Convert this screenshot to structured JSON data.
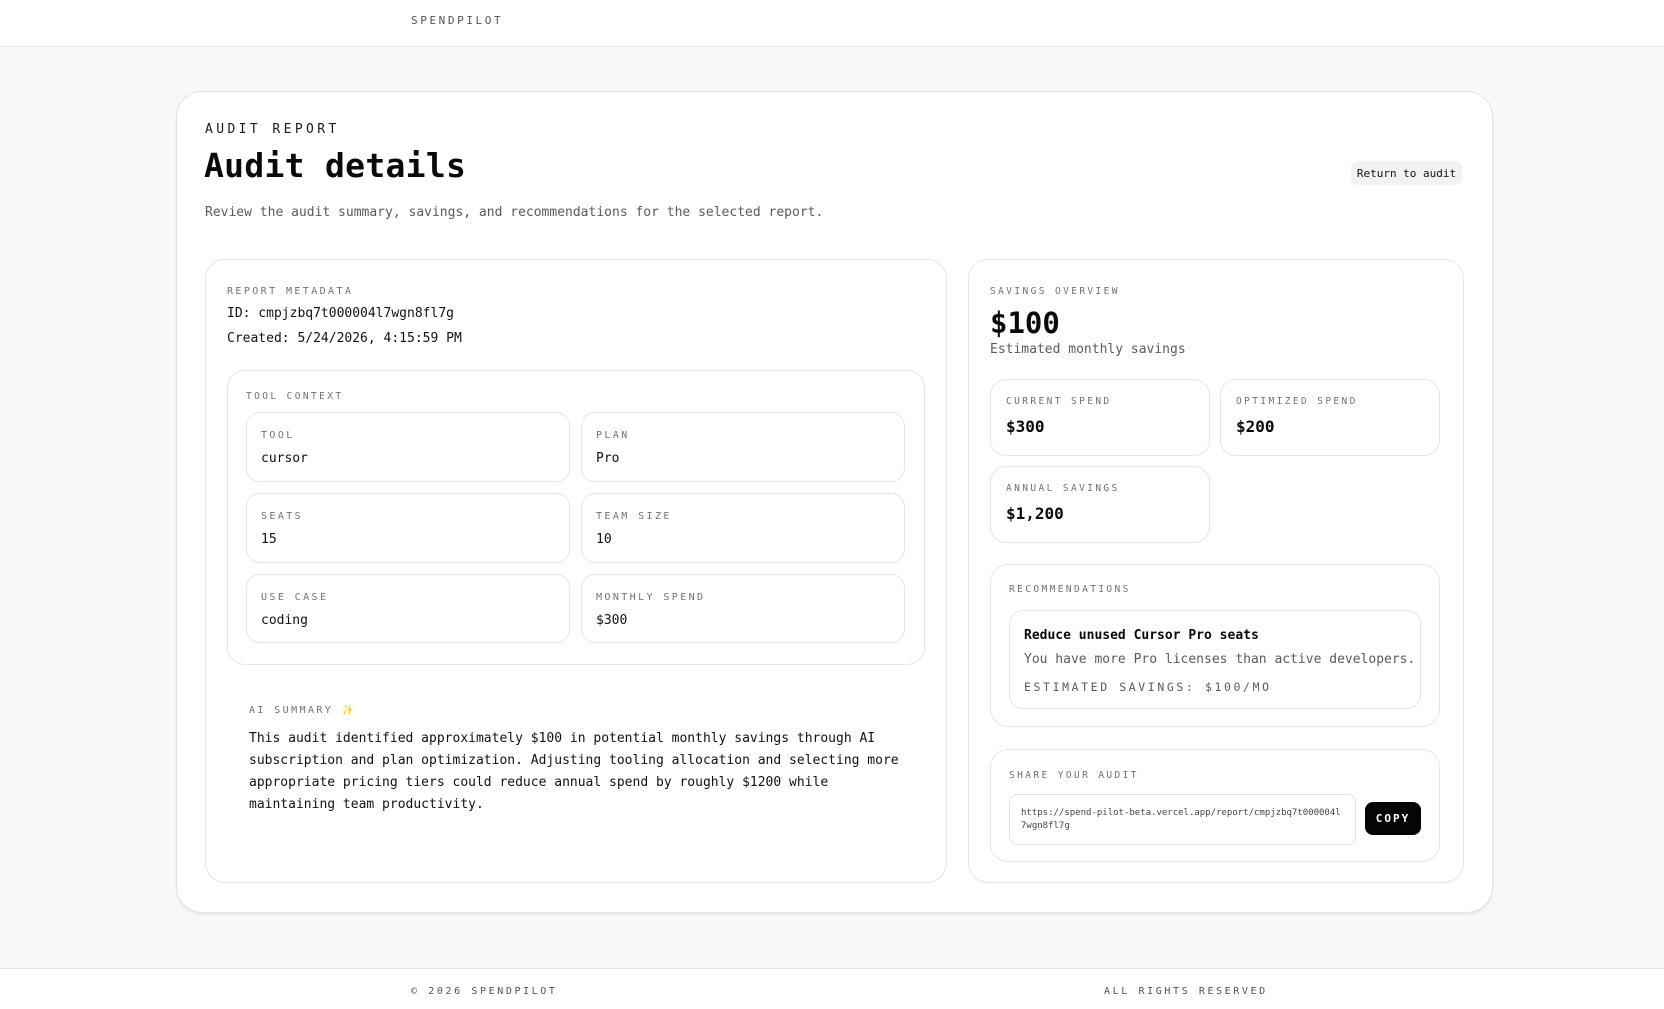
{
  "brand": "SPENDPILOT",
  "header": {
    "eyebrow": "AUDIT REPORT",
    "title": "Audit details",
    "subtitle": "Review the audit summary, savings, and recommendations for the selected report.",
    "return_label": "Return to audit"
  },
  "metadata": {
    "label": "REPORT METADATA",
    "id_line": "ID: cmpjzbq7t000004l7wgn8fl7g",
    "created_line": "Created: 5/24/2026, 4:15:59 PM"
  },
  "tool_context": {
    "label": "TOOL CONTEXT",
    "fields": [
      {
        "label": "TOOL",
        "value": "cursor"
      },
      {
        "label": "PLAN",
        "value": "Pro"
      },
      {
        "label": "SEATS",
        "value": "15"
      },
      {
        "label": "TEAM SIZE",
        "value": "10"
      },
      {
        "label": "USE CASE",
        "value": "coding"
      },
      {
        "label": "MONTHLY SPEND",
        "value": "$300"
      }
    ]
  },
  "ai_summary": {
    "label": "AI SUMMARY",
    "icon": "sparkle-icon",
    "icon_glyph": "✨",
    "text": "This audit identified approximately $100 in potential monthly savings through AI subscription and plan optimization. Adjusting tooling allocation and selecting more appropriate pricing tiers could reduce annual spend by roughly $1200 while maintaining team productivity."
  },
  "savings": {
    "label": "SAVINGS OVERVIEW",
    "amount": "$100",
    "amount_caption": "Estimated monthly savings",
    "stats": [
      {
        "label": "CURRENT SPEND",
        "value": "$300"
      },
      {
        "label": "OPTIMIZED SPEND",
        "value": "$200"
      },
      {
        "label": "ANNUAL SAVINGS",
        "value": "$1,200"
      }
    ]
  },
  "recommendations": {
    "label": "RECOMMENDATIONS",
    "items": [
      {
        "title": "Reduce unused Cursor Pro seats",
        "description": "You have more Pro licenses than active developers.",
        "estimate": "ESTIMATED SAVINGS: $100/MO"
      }
    ]
  },
  "share": {
    "label": "SHARE YOUR AUDIT",
    "url": "https://spend-pilot-beta.vercel.app/report/cmpjzbq7t000004l7wgn8fl7g",
    "copy_label": "COPY"
  },
  "footer": {
    "left": "© 2026 SPENDPILOT",
    "right": "ALL RIGHTS RESERVED"
  },
  "colors": {
    "background": "#f7f8fa",
    "accent_sparkle": "#f08a3c",
    "copy_button": "#050505"
  }
}
